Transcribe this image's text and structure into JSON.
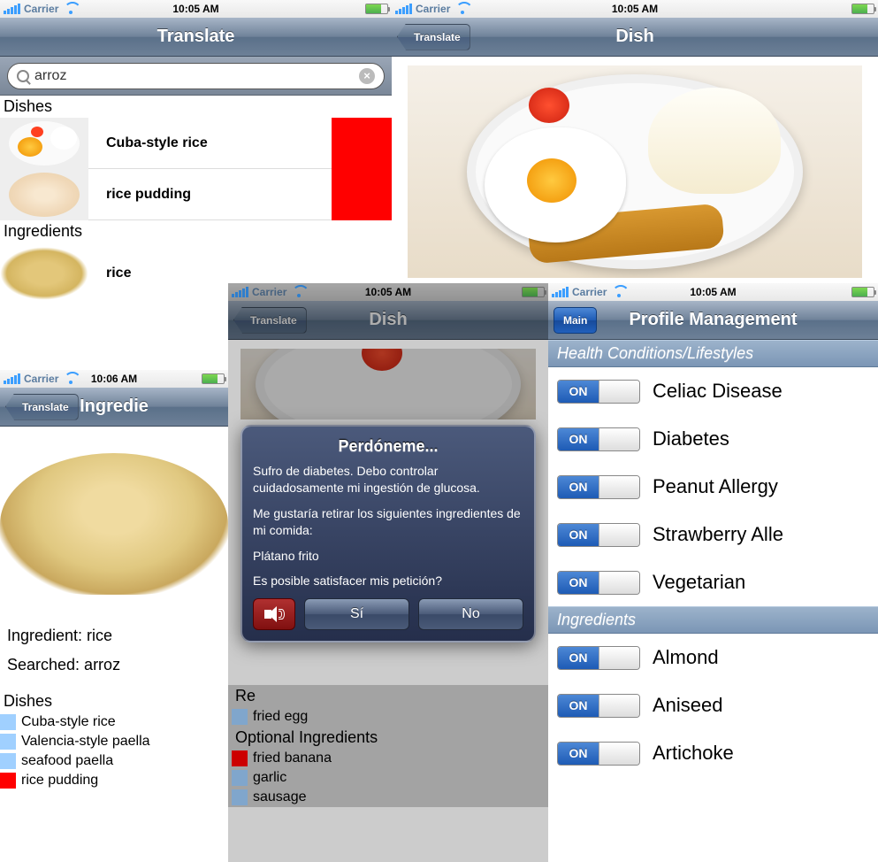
{
  "status": {
    "carrier": "Carrier",
    "time1": "10:05 AM",
    "time2": "10:06 AM"
  },
  "screen1": {
    "title": "Translate",
    "search_value": "arroz",
    "dishes_header": "Dishes",
    "dishes": [
      {
        "label": "Cuba-style rice"
      },
      {
        "label": "rice pudding"
      }
    ],
    "ingredients_header": "Ingredients",
    "ingredients": [
      {
        "label": "rice"
      }
    ]
  },
  "screen2": {
    "back": "Translate",
    "title": "Dish"
  },
  "screen3": {
    "back": "Translate",
    "title": "Ingredie",
    "ingredient_label": "Ingredient: rice",
    "searched_label": "Searched: arroz",
    "dishes_header": "Dishes",
    "dishes": [
      {
        "color": "#a0d0ff",
        "label": "Cuba-style rice"
      },
      {
        "color": "#a0d0ff",
        "label": "Valencia-style paella"
      },
      {
        "color": "#a0d0ff",
        "label": "seafood paella"
      },
      {
        "color": "#ff0000",
        "label": "rice pudding"
      }
    ]
  },
  "screen4": {
    "back": "Translate",
    "title": "Dish",
    "required_header": "Re",
    "required": [
      {
        "color": "#a0d0ff",
        "label": "fried egg"
      }
    ],
    "optional_header": "Optional Ingredients",
    "optional": [
      {
        "color": "#ff0000",
        "label": "fried banana"
      },
      {
        "color": "#a0d0ff",
        "label": "garlic"
      },
      {
        "color": "#a0d0ff",
        "label": "sausage"
      }
    ],
    "alert": {
      "title": "Perdóneme...",
      "p1": "Sufro de diabetes. Debo controlar cuidadosamente mi ingestión de glucosa.",
      "p2": "Me gustaría retirar los siguientes ingredientes de mi comida:",
      "p3": "Plátano frito",
      "p4": "Es posible satisfacer mis petición?",
      "yes": "Sí",
      "no": "No"
    }
  },
  "screen5": {
    "main": "Main",
    "title": "Profile Management",
    "sec1": "Health Conditions/Lifestyles",
    "conditions": [
      {
        "label": "Celiac Disease",
        "on": "ON"
      },
      {
        "label": "Diabetes",
        "on": "ON"
      },
      {
        "label": "Peanut Allergy",
        "on": "ON"
      },
      {
        "label": "Strawberry Alle",
        "on": "ON"
      },
      {
        "label": "Vegetarian",
        "on": "ON"
      }
    ],
    "sec2": "Ingredients",
    "ingredients": [
      {
        "label": "Almond",
        "on": "ON"
      },
      {
        "label": "Aniseed",
        "on": "ON"
      },
      {
        "label": "Artichoke",
        "on": "ON"
      }
    ]
  }
}
